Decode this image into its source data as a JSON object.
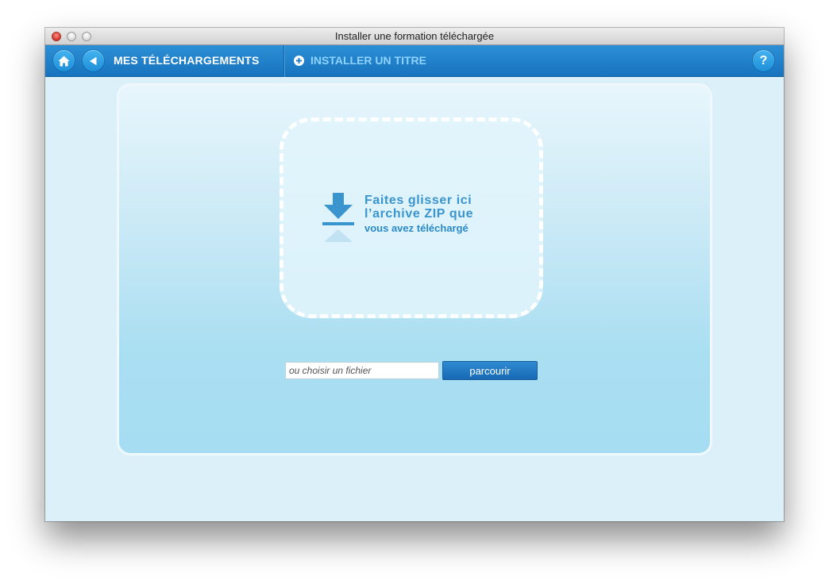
{
  "window": {
    "title": "Installer une formation téléchargée"
  },
  "toolbar": {
    "nav_title": "MES TÉLÉCHARGEMENTS",
    "install_title": "INSTALLER UN TITRE",
    "help_label": "?",
    "icons": {
      "home": "home-icon",
      "back": "back-arrow-icon",
      "install": "plus-circle-icon",
      "help": "help-icon"
    }
  },
  "dropzone": {
    "line1": "Faites glisser ici",
    "line2": "l’archive ZIP que",
    "line3": "vous avez téléchargé",
    "icon": "download-arrow-icon"
  },
  "file_picker": {
    "placeholder": "ou choisir un fichier",
    "value": "",
    "browse_label": "parcourir"
  },
  "colors": {
    "toolbar": "#1f7fc8",
    "accent_text": "#3a95cf",
    "background": "#dcf0fa"
  }
}
